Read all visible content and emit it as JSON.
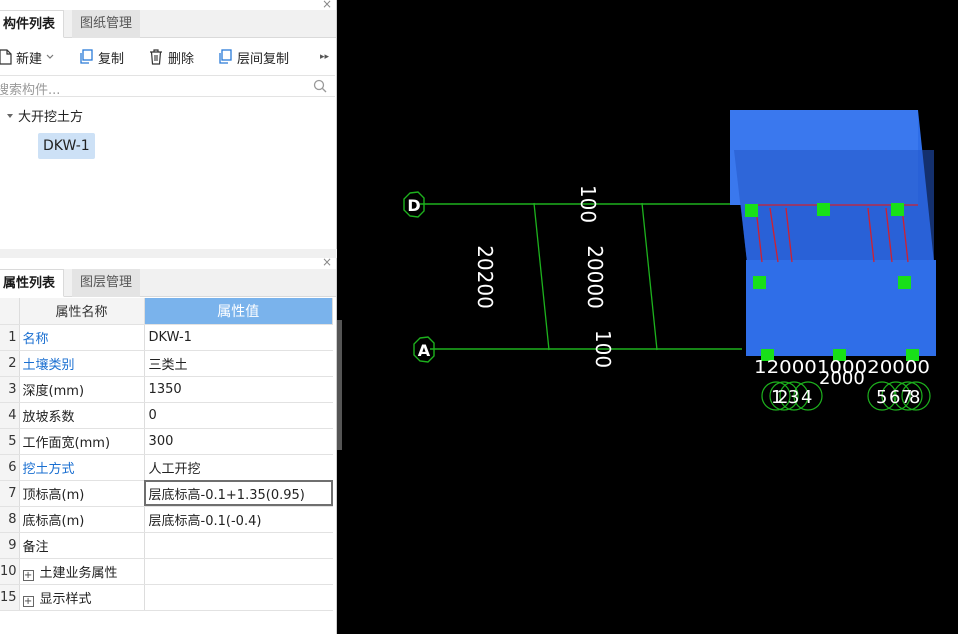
{
  "component_panel": {
    "close": "×",
    "tabs": [
      "构件列表",
      "图纸管理"
    ],
    "toolbar": {
      "new": "新建",
      "copy": "复制",
      "delete": "删除",
      "floor_copy": "层间复制",
      "more": "▸▸"
    },
    "search_placeholder": "搜索构件...",
    "tree": {
      "root": "大开挖土方",
      "leaf": "DKW-1"
    }
  },
  "property_panel": {
    "close": "×",
    "tabs": [
      "属性列表",
      "图层管理"
    ],
    "headers": {
      "name": "属性名称",
      "value": "属性值"
    },
    "rows": [
      {
        "num": "1",
        "name": "名称",
        "value": "DKW-1"
      },
      {
        "num": "2",
        "name": "土壤类别",
        "value": "三类土"
      },
      {
        "num": "3",
        "name": "深度(mm)",
        "value": "1350"
      },
      {
        "num": "4",
        "name": "放坡系数",
        "value": "0"
      },
      {
        "num": "5",
        "name": "工作面宽(mm)",
        "value": "300"
      },
      {
        "num": "6",
        "name": "挖土方式",
        "value": "人工开挖"
      },
      {
        "num": "7",
        "name": "顶标高(m)",
        "value": "层底标高-0.1+1.35(0.95)"
      },
      {
        "num": "8",
        "name": "底标高(m)",
        "value": "层底标高-0.1(-0.4)"
      },
      {
        "num": "9",
        "name": "备注",
        "value": ""
      },
      {
        "num": "10",
        "name": "土建业务属性",
        "value": ""
      },
      {
        "num": "15",
        "name": "显示样式",
        "value": ""
      }
    ],
    "expander_symbol": "+"
  },
  "viewport": {
    "axis_labels": {
      "top": "D",
      "bottom": "A",
      "bottom_right": [
        "1",
        "2",
        "3",
        "4",
        "5",
        "6",
        "7",
        "8"
      ]
    },
    "dimensions": {
      "total": "20200",
      "top_offset": "100",
      "span": "20000",
      "bottom_offset": "100",
      "right_cluster": "12000100020000",
      "right_span": "2000"
    },
    "colors": {
      "axis_line": "#1db11d",
      "pit_fill": "#2f6ee8",
      "marker": "#18e018",
      "rebar": "#d02030",
      "text": "#ffffff"
    }
  }
}
